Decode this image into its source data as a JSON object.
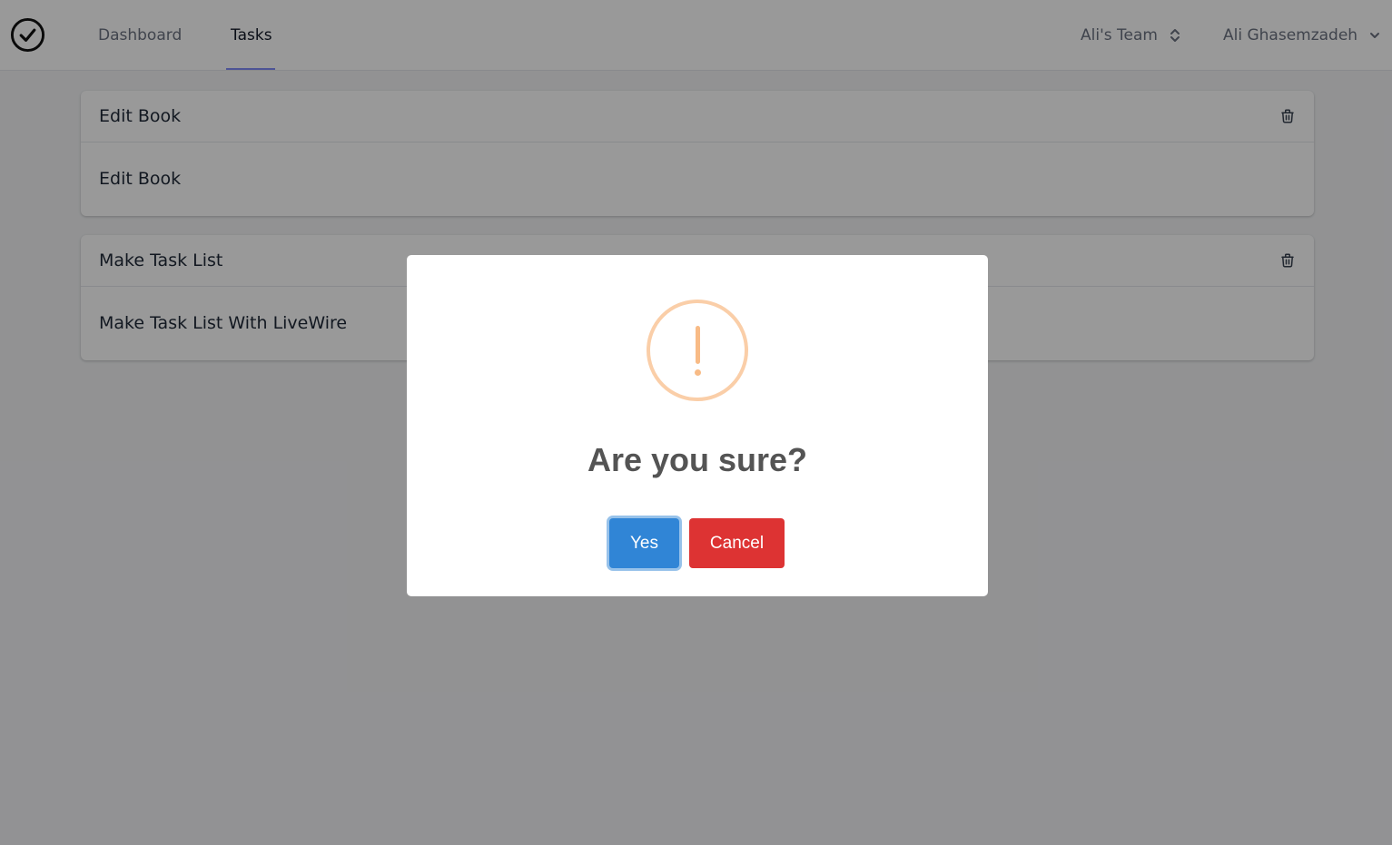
{
  "nav": {
    "links": [
      "Dashboard",
      "Tasks"
    ],
    "active_tab": "Tasks",
    "team_name": "Ali's Team",
    "user_name": "Ali Ghasemzadeh"
  },
  "tasks": [
    {
      "title": "Edit Book",
      "description": "Edit Book"
    },
    {
      "title": "Make Task List",
      "description": "Make Task List With LiveWire"
    }
  ],
  "modal": {
    "icon": "warning-icon",
    "title": "Are you sure?",
    "confirm_label": "Yes",
    "cancel_label": "Cancel"
  },
  "colors": {
    "confirm": "#3085d6",
    "cancel": "#dd3333",
    "warning": "#f8bb86",
    "nav_active_underline": "#818cf8"
  }
}
